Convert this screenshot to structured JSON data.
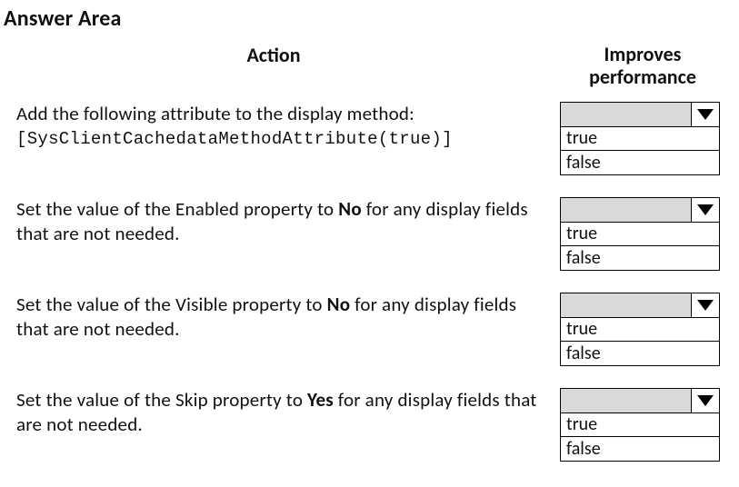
{
  "title": "Answer Area",
  "headers": {
    "action": "Action",
    "improves_line1": "Improves",
    "improves_line2": "performance"
  },
  "rows": [
    {
      "action_text": "Add the following attribute to the display method:",
      "code_text": "[SysClientCachedataMethodAttribute(true)]",
      "dropdown": {
        "selected": "",
        "options": [
          "true",
          "false"
        ]
      }
    },
    {
      "action_html": "Set the value of the Enabled property to <b>No</b> for any display fields that are not needed.",
      "dropdown": {
        "selected": "",
        "options": [
          "true",
          "false"
        ]
      }
    },
    {
      "action_html": "Set the value of the Visible property to <b>No</b> for any display fields that are not needed.",
      "dropdown": {
        "selected": "",
        "options": [
          "true",
          "false"
        ]
      }
    },
    {
      "action_html": "Set the value of the Skip property to <b>Yes</b> for any display fields that are not needed.",
      "dropdown": {
        "selected": "",
        "options": [
          "true",
          "false"
        ]
      }
    }
  ]
}
